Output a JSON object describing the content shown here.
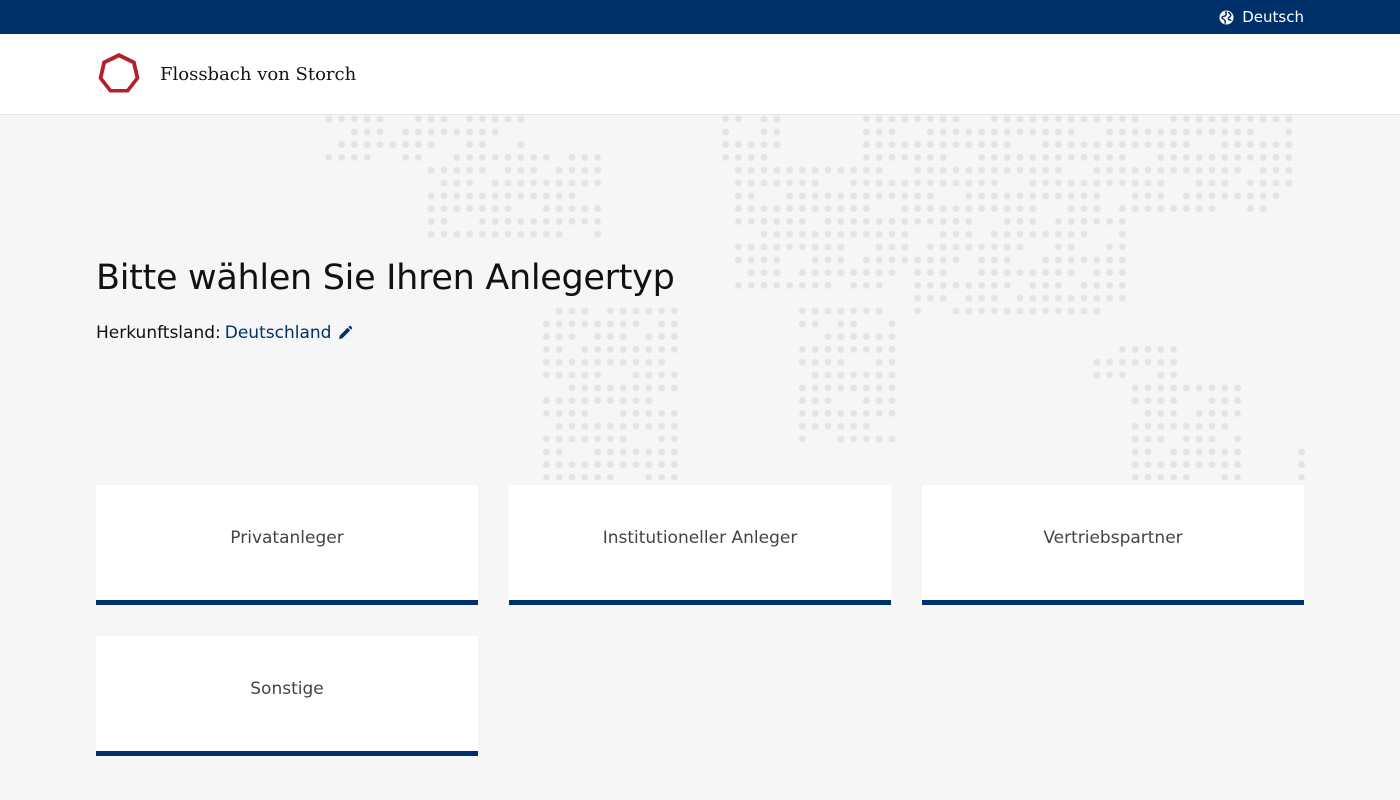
{
  "topbar": {
    "language_label": "Deutsch",
    "language_icon": "globe-icon",
    "background": "#00306a"
  },
  "header": {
    "brand_name": "Flossbach von Storch",
    "logo_icon": "heptagon-logo",
    "logo_color": "#b3222c"
  },
  "main": {
    "headline": "Bitte wählen Sie Ihren Anlegertyp",
    "country_label": "Herkunftsland:",
    "country_value": "Deutschland",
    "edit_icon": "pencil-icon",
    "background_image": "dotted-world-map"
  },
  "investor_types": [
    {
      "label": "Privatanleger"
    },
    {
      "label": "Institutioneller Anleger"
    },
    {
      "label": "Vertriebspartner"
    },
    {
      "label": "Sonstige"
    }
  ],
  "colors": {
    "accent": "#00306a",
    "page_background": "#f6f6f6",
    "card_background": "#ffffff"
  }
}
